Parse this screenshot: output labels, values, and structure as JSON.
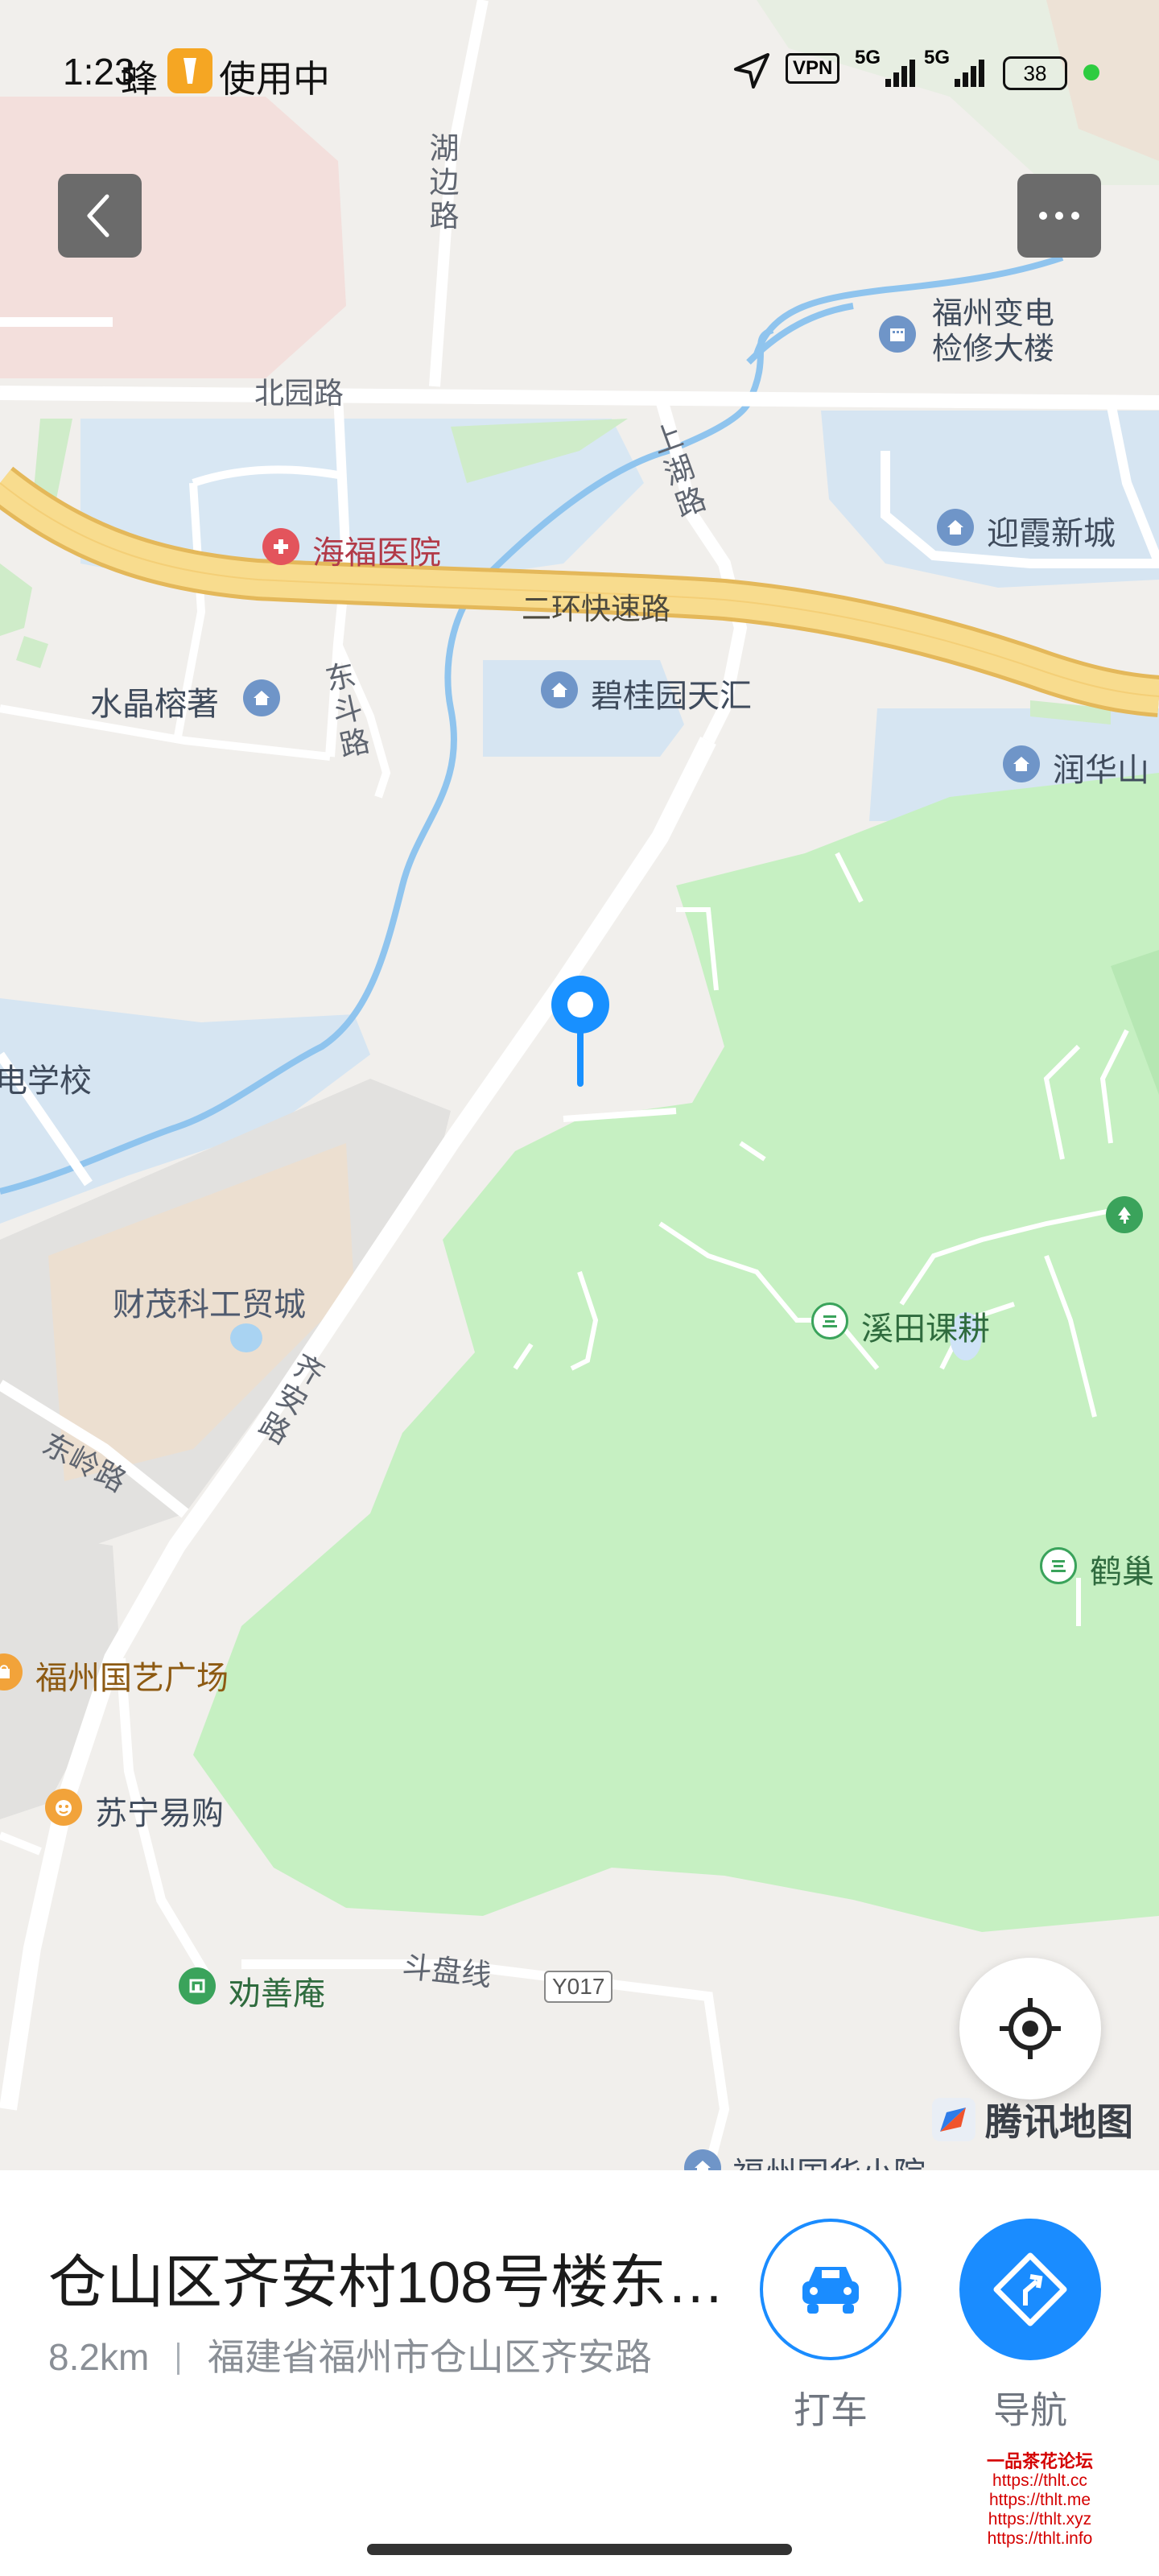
{
  "status_bar": {
    "time": "1:23",
    "notification_text": "蜂",
    "in_use_text": "使用中",
    "vpn": "VPN",
    "network_1": "5G",
    "network_2": "5G",
    "battery": "38"
  },
  "map": {
    "road_labels": {
      "beiyuan": "北园路",
      "erhuan": "二环快速路",
      "dongling": "东岭路",
      "doupan": "斗盘线",
      "y017": "Y017"
    },
    "vertical_road_labels": {
      "hubian": "湖边路",
      "shanghu": "上湖路",
      "dongdou": "东斗路",
      "qian": "齐安路"
    },
    "pois": {
      "fuzhou_power": "福州变电\n检修大楼",
      "yingxia": "迎霞新城",
      "haifu": "海福医院",
      "shuijing": "水晶榕著",
      "biguiyuan": "碧桂园天汇",
      "runhua": "润华山",
      "school": "电学校",
      "caimao": "财茂科工贸城",
      "xitian": "溪田课耕",
      "hechao": "鹤巢",
      "guoyi": "福州国艺广场",
      "suning": "苏宁易购",
      "quanshan": "劝善庵",
      "guohua": "福州国华小院"
    },
    "brand": "腾讯地图"
  },
  "panel": {
    "title": "仓山区齐安村108号楼东…",
    "distance": "8.2km",
    "address": "福建省福州市仓山区齐安路",
    "taxi_label": "打车",
    "nav_label": "导航"
  },
  "watermark": {
    "title": "一品茶花论坛",
    "urls": [
      "https://thlt.cc",
      "https://thlt.me",
      "https://thlt.xyz",
      "https://thlt.info"
    ]
  },
  "colors": {
    "accent": "#1a8cff",
    "pin": "#1890ff",
    "park_green": "#c6f0c2",
    "water": "#cfe3f7",
    "expressway": "#f5d27a"
  }
}
